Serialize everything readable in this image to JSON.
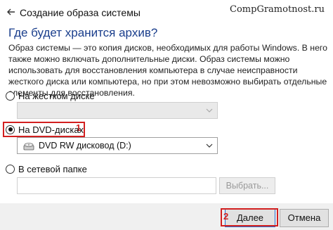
{
  "window": {
    "title": "Создание образа системы",
    "watermark": "CompGramotnost.ru"
  },
  "page": {
    "heading": "Где будет хранится архив?",
    "description": "Образ системы — это копия дисков, необходимых для работы Windows. В него также можно включать дополнительные диски. Образ системы можно использовать для восстановления компьютера в случае неисправности жесткого диска или компьютера, но при этом невозможно выбирать отдельные элементы для восстановления."
  },
  "options": {
    "hard_disk": {
      "label": "На жестком диске",
      "selected": false,
      "value": ""
    },
    "dvd": {
      "label": "На DVD-дисках",
      "selected": true,
      "value": "DVD RW дисковод (D:)",
      "value_icon": "dvd-drive-icon"
    },
    "network": {
      "label": "В сетевой папке",
      "selected": false,
      "path": "",
      "browse_label": "Выбрать..."
    }
  },
  "annotations": {
    "dvd_badge": "1",
    "next_badge": "2",
    "highlight_color": "#d21f1f"
  },
  "footer": {
    "next_label": "Далее",
    "cancel_label": "Отмена"
  },
  "colors": {
    "heading": "#1a3e8c",
    "footer_bg": "#f0f0f0",
    "primary_border": "#2a6fd1"
  }
}
